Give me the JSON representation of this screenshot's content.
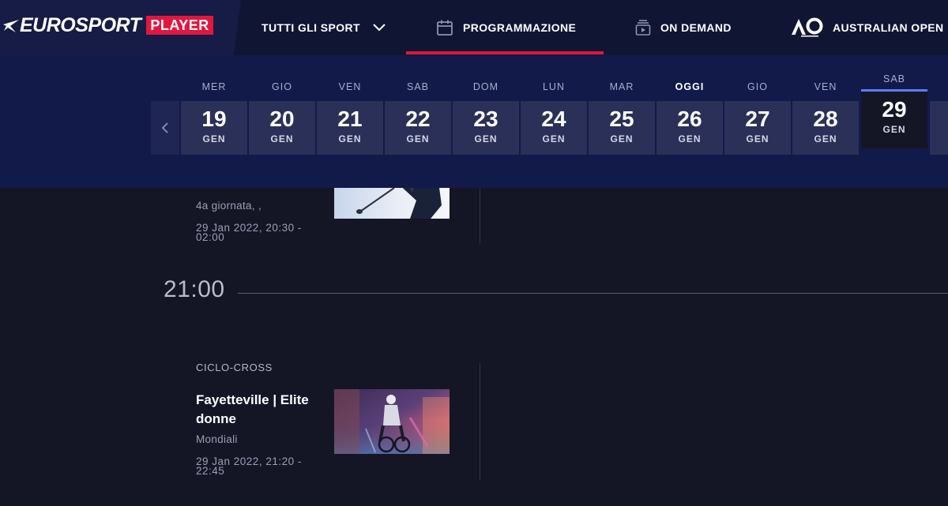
{
  "brand": {
    "logo_text": "EUROSPORT",
    "player_badge": "PLAYER"
  },
  "nav": {
    "sports": {
      "label": "TUTTI GLI SPORT",
      "icon": "chevron-down-icon"
    },
    "schedule": {
      "label": "PROGRAMMAZIONE",
      "icon": "calendar-icon",
      "active": true
    },
    "on_demand": {
      "label": "ON DEMAND",
      "icon": "video-stack-icon"
    },
    "australian_open": {
      "label": "AUSTRALIAN OPEN",
      "icon": "ao-logo-icon"
    }
  },
  "datebar": {
    "prev_icon": "chevron-left-icon",
    "days": [
      {
        "name": "MER",
        "num": "19",
        "month": "GEN"
      },
      {
        "name": "GIO",
        "num": "20",
        "month": "GEN"
      },
      {
        "name": "VEN",
        "num": "21",
        "month": "GEN"
      },
      {
        "name": "SAB",
        "num": "22",
        "month": "GEN"
      },
      {
        "name": "DOM",
        "num": "23",
        "month": "GEN"
      },
      {
        "name": "LUN",
        "num": "24",
        "month": "GEN"
      },
      {
        "name": "MAR",
        "num": "25",
        "month": "GEN"
      },
      {
        "name": "OGGI",
        "num": "26",
        "month": "GEN"
      },
      {
        "name": "GIO",
        "num": "27",
        "month": "GEN"
      },
      {
        "name": "VEN",
        "num": "28",
        "month": "GEN"
      },
      {
        "name": "SAB",
        "num": "29",
        "month": "GEN"
      }
    ],
    "today_index": 7,
    "selected_index": 10
  },
  "schedule": {
    "event1": {
      "subtitle": "4a giornata, ,",
      "time_range": "29 Jan 2022, 20:30 - 02:00"
    },
    "hour_marker": "21:00",
    "event2": {
      "category": "CICLO-CROSS",
      "title": "Fayetteville | Elite donne",
      "subtitle": "Mondiali",
      "time_range": "29 Jan 2022, 21:20 - 22:45"
    }
  },
  "colors": {
    "accent_red": "#e0173f",
    "selected_blue": "#5b7bff",
    "nav_bg": "#101534",
    "datebar_bg": "#121a4a",
    "page_bg": "#141626"
  }
}
